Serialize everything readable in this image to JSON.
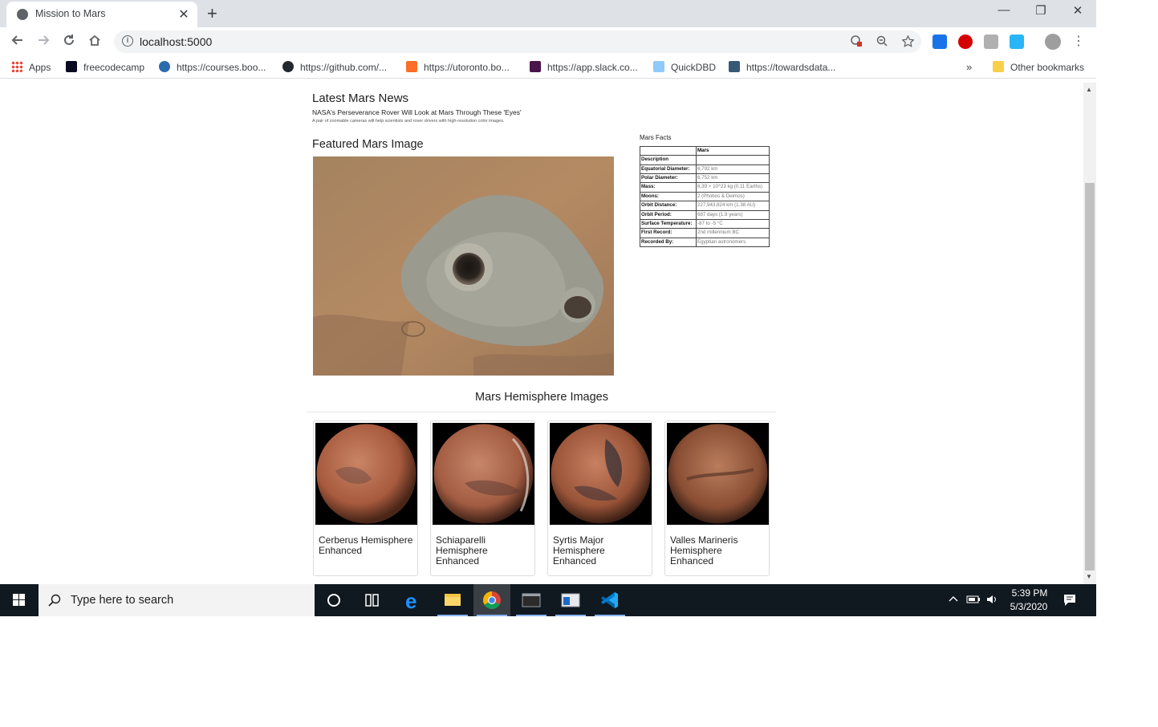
{
  "browser": {
    "tab_title": "Mission to Mars",
    "tab_close": "✕",
    "new_tab": "+",
    "url": "localhost:5000",
    "window_controls": {
      "minimize": "—",
      "restore": "❐",
      "close": "✕"
    }
  },
  "bookmarks": {
    "items": [
      {
        "label": "Apps",
        "icon": "apps-grid-icon"
      },
      {
        "label": "freecodecamp",
        "icon": "freecodecamp-icon"
      },
      {
        "label": "https://courses.boo...",
        "icon": "courses-icon"
      },
      {
        "label": "https://github.com/...",
        "icon": "github-icon"
      },
      {
        "label": "https://utoronto.bo...",
        "icon": "gitlab-icon"
      },
      {
        "label": "https://app.slack.co...",
        "icon": "slack-icon"
      },
      {
        "label": "QuickDBD",
        "icon": "quickdbd-icon"
      },
      {
        "label": "https://towardsdata...",
        "icon": "tds-icon"
      }
    ],
    "overflow": "»",
    "other": "Other bookmarks"
  },
  "page": {
    "news_heading": "Latest Mars News",
    "news_title": "NASA's Perseverance Rover Will Look at Mars Through These 'Eyes'",
    "news_paragraph": "A pair of zoomable cameras will help scientists and rover drivers with high-resolution color images.",
    "featured_heading": "Featured Mars Image",
    "facts_caption": "Mars Facts",
    "facts_header": "Mars",
    "facts_desc_label": "Description",
    "facts": [
      {
        "k": "Equatorial Diameter:",
        "v": "6,792 km"
      },
      {
        "k": "Polar Diameter:",
        "v": "6,752 km"
      },
      {
        "k": "Mass:",
        "v": "6.39 × 10^23 kg (0.11 Earths)"
      },
      {
        "k": "Moons:",
        "v": "2 (Phobos & Deimos)"
      },
      {
        "k": "Orbit Distance:",
        "v": "227,943,824 km (1.38 AU)"
      },
      {
        "k": "Orbit Period:",
        "v": "687 days (1.9 years)"
      },
      {
        "k": "Surface Temperature:",
        "v": "-87 to -5 °C"
      },
      {
        "k": "First Record:",
        "v": "2nd millennium BC"
      },
      {
        "k": "Recorded By:",
        "v": "Egyptian astronomers"
      }
    ],
    "hemi_heading": "Mars Hemisphere Images",
    "hemispheres": [
      {
        "title": "Cerberus Hemisphere Enhanced"
      },
      {
        "title": "Schiaparelli Hemisphere Enhanced"
      },
      {
        "title": "Syrtis Major Hemisphere Enhanced"
      },
      {
        "title": "Valles Marineris Hemisphere Enhanced"
      }
    ]
  },
  "taskbar": {
    "search_placeholder": "Type here to search",
    "time": "5:39 PM",
    "date": "5/3/2020"
  }
}
